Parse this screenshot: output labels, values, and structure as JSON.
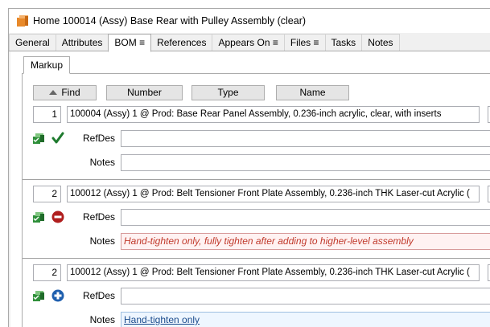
{
  "window": {
    "title": "Home 100014 (Assy) Base Rear with Pulley Assembly (clear)"
  },
  "tabs": [
    {
      "label": "General"
    },
    {
      "label": "Attributes"
    },
    {
      "label": "BOM ≡"
    },
    {
      "label": "References"
    },
    {
      "label": "Appears On ≡"
    },
    {
      "label": "Files ≡"
    },
    {
      "label": "Tasks"
    },
    {
      "label": "Notes"
    }
  ],
  "subtab": {
    "label": "Markup"
  },
  "columns": {
    "find": "Find",
    "number": "Number",
    "type": "Type",
    "name": "Name"
  },
  "rows": [
    {
      "find": "1",
      "description": "100004 (Assy) 1 @ Prod: Base Rear Panel Assembly, 0.236-inch acrylic, clear, with inserts",
      "status_icon": "check-icon",
      "refdes_label": "RefDes",
      "refdes_value": "",
      "notes_label": "Notes",
      "notes_value": ""
    },
    {
      "find": "2",
      "description": "100012 (Assy) 1 @ Prod: Belt Tensioner Front Plate Assembly, 0.236-inch THK Laser-cut Acrylic (",
      "status_icon": "remove-icon",
      "refdes_label": "RefDes",
      "refdes_value": "",
      "notes_label": "Notes",
      "notes_value": "Hand-tighten only, fully tighten after adding to higher-level assembly"
    },
    {
      "find": "2",
      "description": "100012 (Assy) 1 @ Prod: Belt Tensioner Front Plate Assembly, 0.236-inch THK Laser-cut Acrylic (",
      "status_icon": "add-icon",
      "refdes_label": "RefDes",
      "refdes_value": "",
      "notes_label": "Notes",
      "notes_value": "Hand-tighten only"
    }
  ],
  "colors": {
    "check": "#1e7a2e",
    "remove": "#b01e1e",
    "add": "#1f5fae",
    "app_icon": "#e8892a"
  }
}
